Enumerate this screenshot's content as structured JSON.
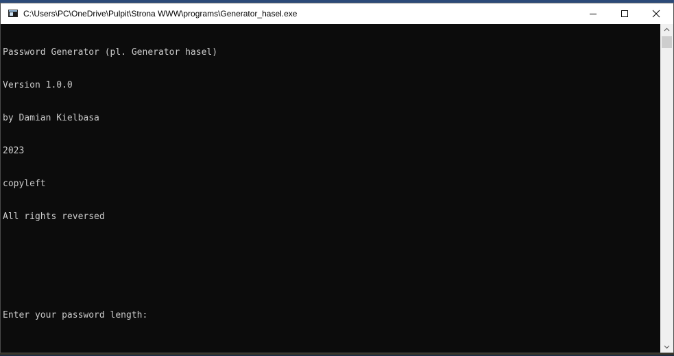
{
  "window": {
    "title": "C:\\Users\\PC\\OneDrive\\Pulpit\\Strona WWW\\programs\\Generator_hasel.exe",
    "icon": "console-app-icon",
    "controls": {
      "minimize": "minimize-icon",
      "maximize": "maximize-icon",
      "close": "close-icon"
    }
  },
  "console": {
    "lines": [
      "Password Generator (pl. Generator hasel)",
      "Version 1.0.0",
      "by Damian Kielbasa",
      "2023",
      "copyleft",
      "All rights reversed",
      "",
      "",
      "Enter your password length:"
    ],
    "background_color": "#0c0c0c",
    "text_color": "#cccccc"
  },
  "scrollbar": {
    "up_icon": "scroll-up-arrow-icon",
    "down_icon": "scroll-down-arrow-icon"
  }
}
